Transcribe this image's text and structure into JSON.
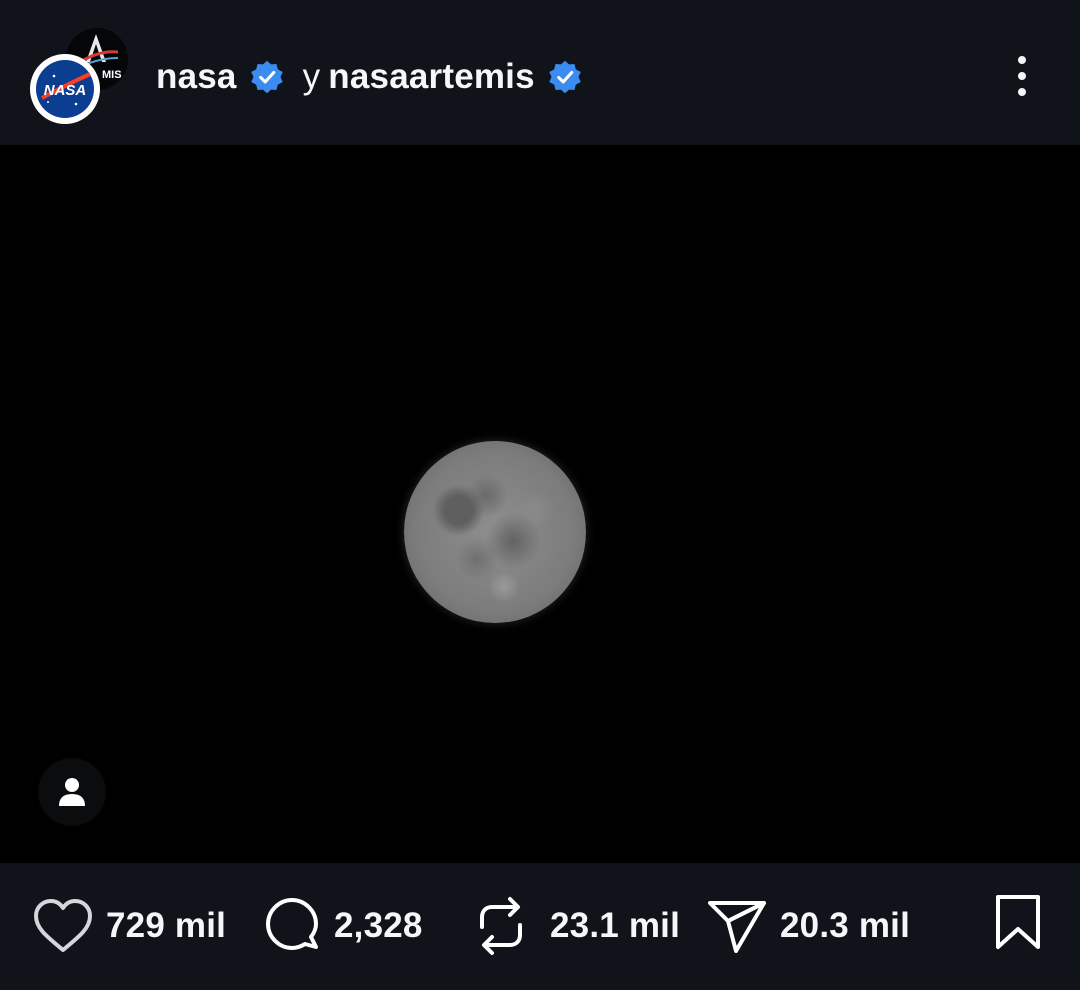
{
  "header": {
    "author_primary": "nasa",
    "connector": "y",
    "author_secondary": "nasaartemis",
    "avatar_front_text": "NASA",
    "avatar_back_text": "MIS"
  },
  "media": {
    "subject": "full moon"
  },
  "actions": {
    "likes": "729 mil",
    "comments": "2,328",
    "reposts": "23.1 mil",
    "shares": "20.3 mil"
  },
  "colors": {
    "background": "#10131a",
    "media_background": "#000000",
    "verified_badge": "#3b8cf0",
    "text": "#f5f6f8"
  },
  "icons": [
    "verified-badge-icon",
    "more-options-icon",
    "tag-person-icon",
    "heart-icon",
    "comment-icon",
    "repost-icon",
    "share-icon",
    "bookmark-icon"
  ]
}
